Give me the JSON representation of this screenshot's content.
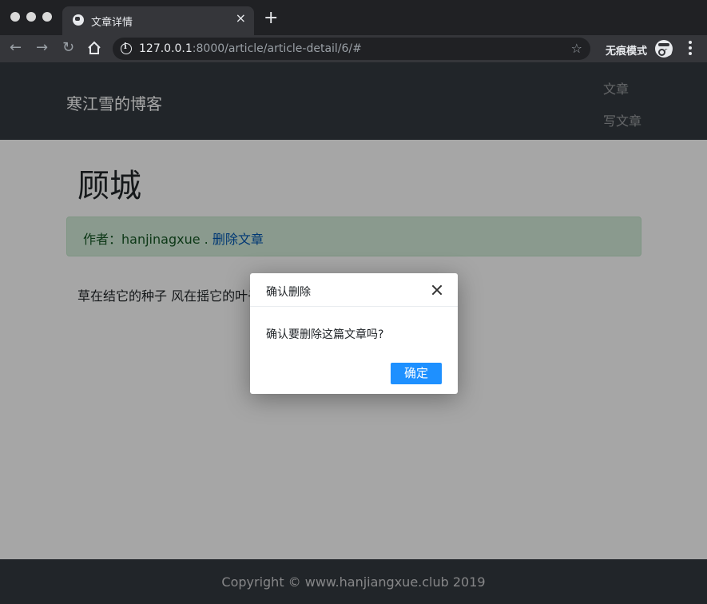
{
  "browser": {
    "tab_title": "文章详情",
    "url_host": "127.0.0.1",
    "url_rest": ":8000/article/article-detail/6/#",
    "incognito_label": "无痕模式",
    "icons": {
      "tab": "globe-icon",
      "close": "close-icon",
      "new_tab": "plus-icon",
      "back": "back-arrow-icon",
      "forward": "forward-arrow-icon",
      "reload": "reload-icon",
      "home": "home-icon",
      "info": "info-icon",
      "bookmark": "star-icon",
      "incognito": "incognito-icon",
      "menu": "kebab-menu-icon"
    }
  },
  "navbar": {
    "brand": "寒江雪的博客",
    "links": [
      {
        "label": "文章"
      },
      {
        "label": "写文章"
      }
    ]
  },
  "article": {
    "title": "顾城",
    "author_prefix": "作者：",
    "author": "hanjinagxue",
    "separator": " . ",
    "delete_link": "删除文章",
    "body": "草在结它的种子 风在摇它的叶子"
  },
  "modal": {
    "title": "确认删除",
    "message": "确认要删除这篇文章吗?",
    "confirm_label": "确定"
  },
  "footer": {
    "text": "Copyright © www.hanjiangxue.club 2019"
  },
  "colors": {
    "navbar": "#343a40",
    "alert_bg": "#d4edda",
    "link": "#0056b3",
    "confirm_button": "#1e90ff"
  }
}
